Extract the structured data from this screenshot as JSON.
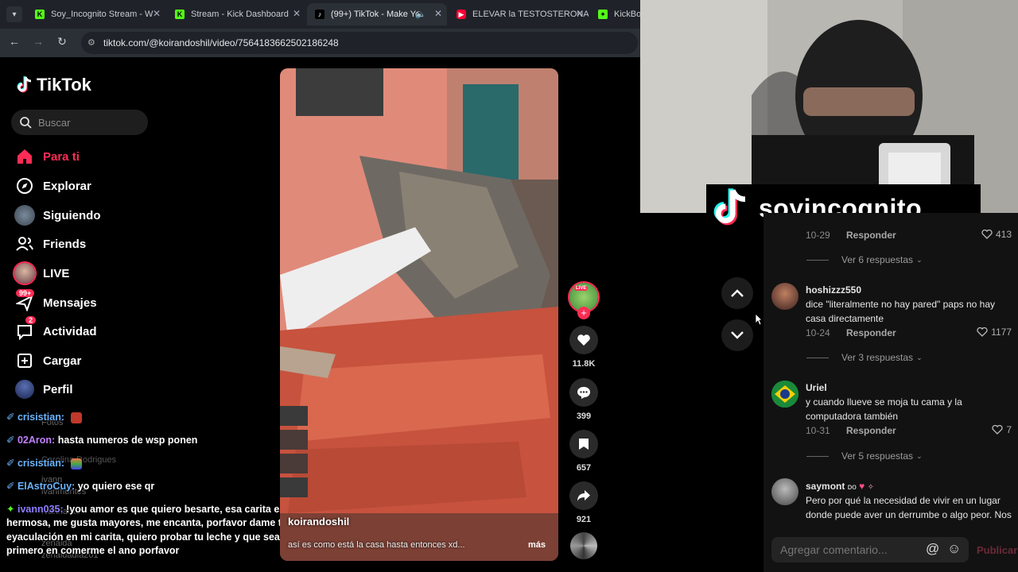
{
  "tabs": [
    {
      "label": "Soy_Incognito Stream - W",
      "active": false,
      "favicon": "kick-icon"
    },
    {
      "label": "Stream - Kick Dashboard",
      "active": false,
      "favicon": "kick-icon"
    },
    {
      "label": "(99+) TikTok - Make Yo",
      "active": true,
      "favicon": "tiktok-icon"
    },
    {
      "label": "ELEVAR la TESTOSTERONA",
      "active": false,
      "favicon": "youtube-icon"
    },
    {
      "label": "KickBot",
      "active": false,
      "favicon": "kick-icon"
    }
  ],
  "address": {
    "url": "tiktok.com/@koirandoshil/video/7564183662502186248"
  },
  "tiktok": {
    "logo": "TikTok",
    "search_placeholder": "Buscar",
    "nav": [
      {
        "label": "Para ti",
        "icon": "home-icon",
        "active": true
      },
      {
        "label": "Explorar",
        "icon": "compass-icon"
      },
      {
        "label": "Siguiendo",
        "icon": "following-avatar-icon"
      },
      {
        "label": "Friends",
        "icon": "friends-icon"
      },
      {
        "label": "LIVE",
        "icon": "live-avatar-icon"
      },
      {
        "label": "Mensajes",
        "icon": "messages-icon",
        "badge": "99+"
      },
      {
        "label": "Actividad",
        "icon": "inbox-icon",
        "badge": "2"
      },
      {
        "label": "Cargar",
        "icon": "upload-icon"
      },
      {
        "label": "Perfil",
        "icon": "profile-avatar-icon"
      }
    ]
  },
  "chat": [
    {
      "user": "crisistian:",
      "msg": ""
    },
    {
      "user": "02Aron:",
      "msg": "hasta numeros de wsp ponen"
    },
    {
      "user": "crisistian:",
      "msg": ""
    },
    {
      "user": "ElAstroCuy:",
      "msg": "yo quiero ese qr"
    },
    {
      "user": "ivann035:",
      "msg": "!you amor es que quiero besarte, esa carita es tan"
    },
    {
      "user": "",
      "msg": "hermosa, me gusta mayores, me encanta, porfavor dame tu"
    },
    {
      "user": "",
      "msg": "eyaculación en mi carita, quiero probar tu leche y que seas el"
    },
    {
      "user": "",
      "msg": "primero en comerme el ano porfavor"
    }
  ],
  "ghost_text": [
    "Fotos",
    "Carolina Rodrigues",
    "ivann",
    "ivanmontes",
    "Ivanna Ko",
    "zenaida",
    "zenaidadia201"
  ],
  "video": {
    "author": "koirandoshil",
    "caption": "así es como está la casa hasta entonces xd...",
    "more": "más",
    "actions": {
      "likes": "11.8K",
      "comments": "399",
      "saves": "657",
      "shares": "921"
    },
    "live_badge": "LIVE"
  },
  "stream_overlay": {
    "name": "soyincognito__"
  },
  "comments": [
    {
      "date": "10-29",
      "reply": "Responder",
      "likes": "413",
      "replies": "Ver 6 respuestas"
    },
    {
      "user": "hoshizzz550",
      "text": "dice \"literalmente no hay pared\" paps no hay casa directamente",
      "date": "10-24",
      "reply": "Responder",
      "likes": "1177",
      "replies": "Ver 3 respuestas"
    },
    {
      "user": "Uriel",
      "text": "y cuando llueve se moja tu cama y la computadora también",
      "date": "10-31",
      "reply": "Responder",
      "likes": "7",
      "replies": "Ver 5 respuestas"
    },
    {
      "user": "saymont",
      "user_suffix": "ᴅᴏ",
      "text": "Pero por qué la necesidad de vivir en un lugar donde puede aver un derrumbe o algo peor. Nos"
    }
  ],
  "comment_input": {
    "placeholder": "Agregar comentario...",
    "post": "Publicar"
  },
  "colors": {
    "accent": "#fe2c55",
    "chat_user": "#6ab3ff"
  }
}
